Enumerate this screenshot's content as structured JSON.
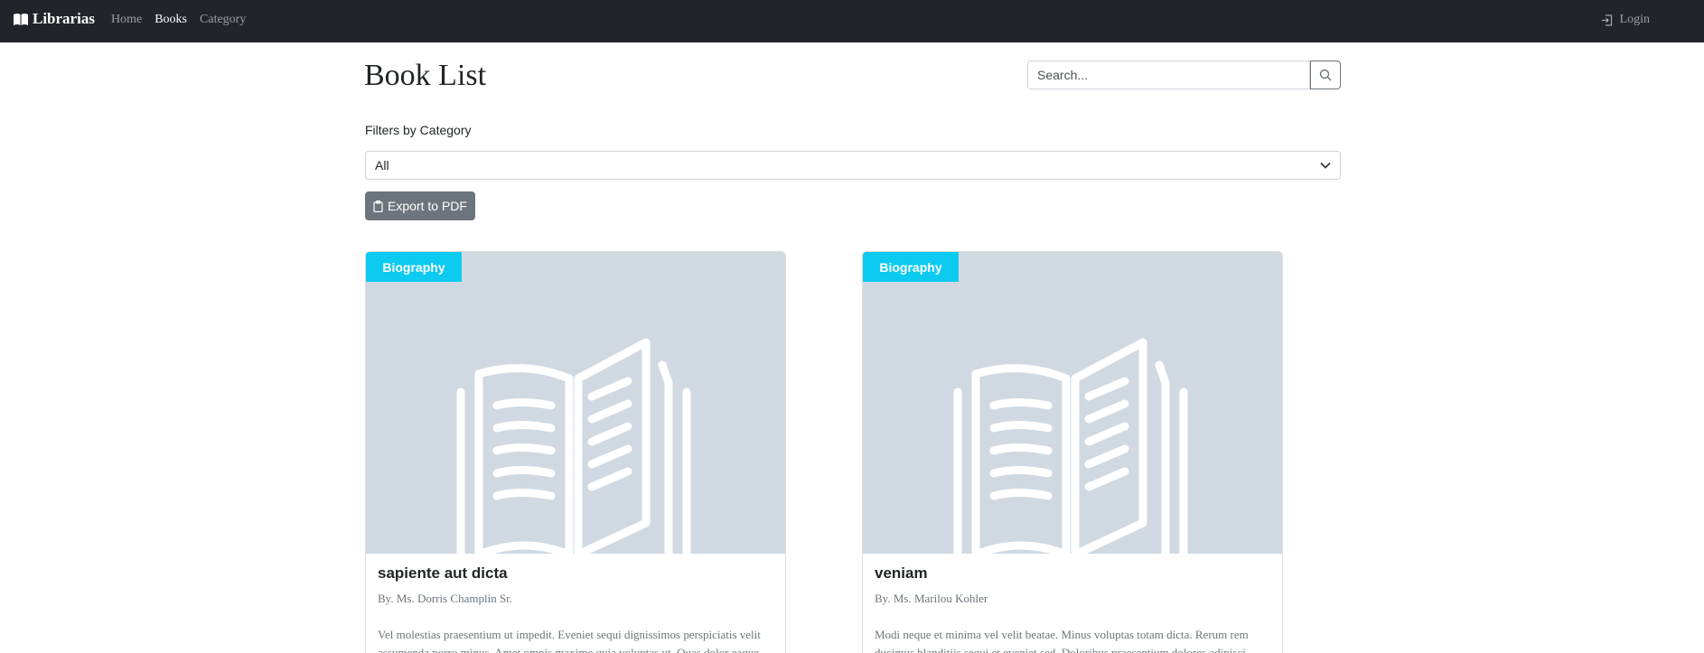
{
  "navbar": {
    "brand": "Librarias",
    "links": [
      {
        "label": "Home",
        "active": false
      },
      {
        "label": "Books",
        "active": true
      },
      {
        "label": "Category",
        "active": false
      }
    ],
    "login_label": "Login"
  },
  "page": {
    "title": "Book List",
    "search_placeholder": "Search...",
    "filter_label": "Filters by Category",
    "filter_selected": "All",
    "export_label": "Export to PDF"
  },
  "books": [
    {
      "category": "Biography",
      "title": "sapiente aut dicta",
      "author": "By. Ms. Dorris Champlin Sr.",
      "description": "Vel molestias praesentium ut impedit. Eveniet sequi dignissimos perspiciatis velit assumenda porro minus. Amet omnis maxime quia voluptas ut. Quas dolor eaque autem sit aut dolorum."
    },
    {
      "category": "Biography",
      "title": "veniam",
      "author": "By. Ms. Marilou Kohler",
      "description": "Modi neque et minima vel velit beatae. Minus voluptas totam dicta. Rerum rem ducimus blanditiis sequi et eveniet sed. Doloribus praesentium dolores adipisci doloribus mollitia."
    }
  ],
  "colors": {
    "navbar_bg": "#212529",
    "badge_bg": "#0dcaf0",
    "button_secondary": "#6c757d",
    "placeholder_bg": "#d0d9e1"
  }
}
